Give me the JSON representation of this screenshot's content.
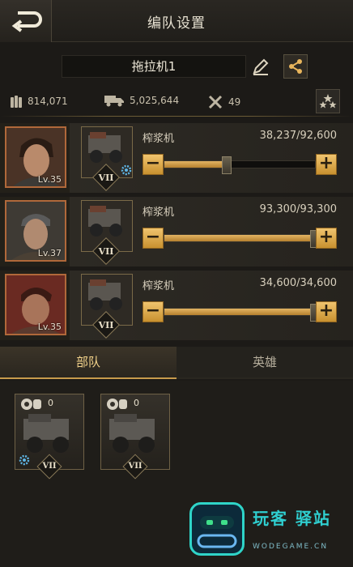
{
  "header": {
    "title": "编队设置",
    "back_icon": "back-arrow-icon"
  },
  "squad_name": "拖拉机1",
  "stats": {
    "ammo": "814,071",
    "transport": "5,025,644",
    "tools": "49"
  },
  "rows": [
    {
      "hero_level": "Lv.35",
      "unit_name": "榨浆机",
      "count": "38,237/92,600",
      "fill_fraction": 0.413,
      "rank": "VII",
      "has_gear_badge": true
    },
    {
      "hero_level": "Lv.37",
      "unit_name": "榨浆机",
      "count": "93,300/93,300",
      "fill_fraction": 1.0,
      "rank": "VII",
      "has_gear_badge": false
    },
    {
      "hero_level": "Lv.35",
      "unit_name": "榨浆机",
      "count": "34,600/34,600",
      "fill_fraction": 1.0,
      "rank": "VII",
      "has_gear_badge": false
    }
  ],
  "tabs": {
    "troops": "部队",
    "heroes": "英雄",
    "active": "troops"
  },
  "cards": [
    {
      "count": "0",
      "rank": "VII",
      "has_gear_badge": true
    },
    {
      "count": "0",
      "rank": "VII",
      "has_gear_badge": false
    }
  ],
  "watermark": {
    "title": "玩客 驿站",
    "sub": "WODEGAME.CN"
  },
  "colors": {
    "accent": "#e3b463",
    "hero_border": "#b0683a",
    "watermark": "#2fd4c8"
  }
}
